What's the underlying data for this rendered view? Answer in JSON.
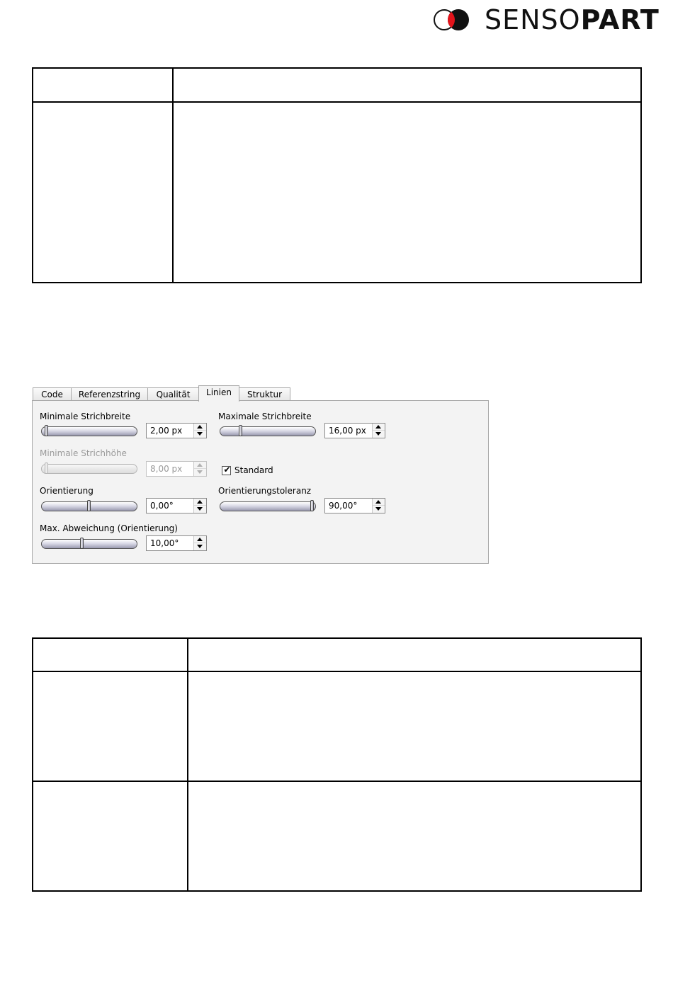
{
  "logo": {
    "prefix": "SENSO",
    "suffix": "PART"
  },
  "dialog": {
    "tabs": [
      {
        "label": "Code",
        "active": false
      },
      {
        "label": "Referenzstring",
        "active": false
      },
      {
        "label": "Qualität",
        "active": false
      },
      {
        "label": "Linien",
        "active": true
      },
      {
        "label": "Struktur",
        "active": false
      }
    ],
    "fields": {
      "min_strichbreite": {
        "label": "Minimale Strichbreite",
        "value": "2,00 px",
        "slider_fraction": 0.02,
        "enabled": true
      },
      "max_strichbreite": {
        "label": "Maximale Strichbreite",
        "value": "16,00 px",
        "slider_fraction": 0.2,
        "enabled": true
      },
      "min_strichhoehe": {
        "label": "Minimale Strichhöhe",
        "value": "8,00 px",
        "slider_fraction": 0.02,
        "enabled": false
      },
      "standard": {
        "label": "Standard",
        "checked": true
      },
      "orientierung": {
        "label": "Orientierung",
        "value": "0,00°",
        "slider_fraction": 0.5
      },
      "orientierungstoleranz": {
        "label": "Orientierungstoleranz",
        "value": "90,00°",
        "slider_fraction": 1.0
      },
      "max_abweichung": {
        "label": "Max. Abweichung (Orientierung)",
        "value": "10,00°",
        "slider_fraction": 0.42
      }
    }
  }
}
